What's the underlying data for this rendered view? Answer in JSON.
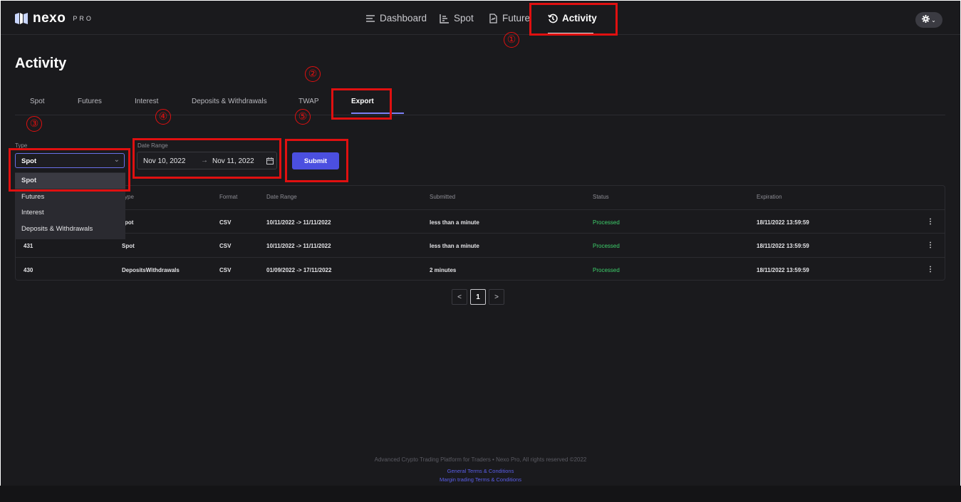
{
  "header": {
    "logo_word": "nexo",
    "logo_suffix": "PRO",
    "nav": [
      {
        "label": "Dashboard",
        "icon": "list-icon"
      },
      {
        "label": "Spot",
        "icon": "chart-icon"
      },
      {
        "label": "Futures",
        "icon": "document-icon"
      },
      {
        "label": "Activity",
        "icon": "history-icon",
        "active": true
      }
    ],
    "settings_icon": "gear-icon"
  },
  "page": {
    "title": "Activity",
    "tabs": [
      "Spot",
      "Futures",
      "Interest",
      "Deposits & Withdrawals",
      "TWAP",
      "Export"
    ],
    "active_tab": "Export"
  },
  "form": {
    "type_label": "Type",
    "type_value": "Spot",
    "type_options": [
      "Spot",
      "Futures",
      "Interest",
      "Deposits & Withdrawals"
    ],
    "date_label": "Date Range",
    "date_start": "Nov 10, 2022",
    "date_end": "Nov 11, 2022",
    "submit_label": "Submit"
  },
  "table": {
    "headers": [
      "ype",
      "Format",
      "Date Range",
      "Submitted",
      "Status",
      "Expiration"
    ],
    "rows": [
      {
        "id": "",
        "type": "pot",
        "format": "CSV",
        "range": "10/11/2022 -> 11/11/2022",
        "submitted": "less than a minute",
        "status": "Processed",
        "expiration": "18/11/2022 13:59:59"
      },
      {
        "id": "431",
        "type": "Spot",
        "format": "CSV",
        "range": "10/11/2022 -> 11/11/2022",
        "submitted": "less than a minute",
        "status": "Processed",
        "expiration": "18/11/2022 13:59:59"
      },
      {
        "id": "430",
        "type": "DepositsWithdrawals",
        "format": "CSV",
        "range": "01/09/2022 -> 17/11/2022",
        "submitted": "2 minutes",
        "status": "Processed",
        "expiration": "18/11/2022 13:59:59"
      }
    ]
  },
  "pagination": {
    "prev": "<",
    "current": "1",
    "next": ">"
  },
  "footer": {
    "text": "Advanced Crypto Trading Platform for Traders • Nexo Pro, All rights reserved ©2022",
    "links": [
      "General Terms & Conditions",
      "Margin trading Terms & Conditions"
    ]
  },
  "annotations": [
    "①",
    "②",
    "③",
    "④",
    "⑤"
  ],
  "colors": {
    "accent": "#4b4fe0",
    "status_ok": "#3ecf6b",
    "annotation": "#e01010",
    "background": "#1a1a1d"
  }
}
